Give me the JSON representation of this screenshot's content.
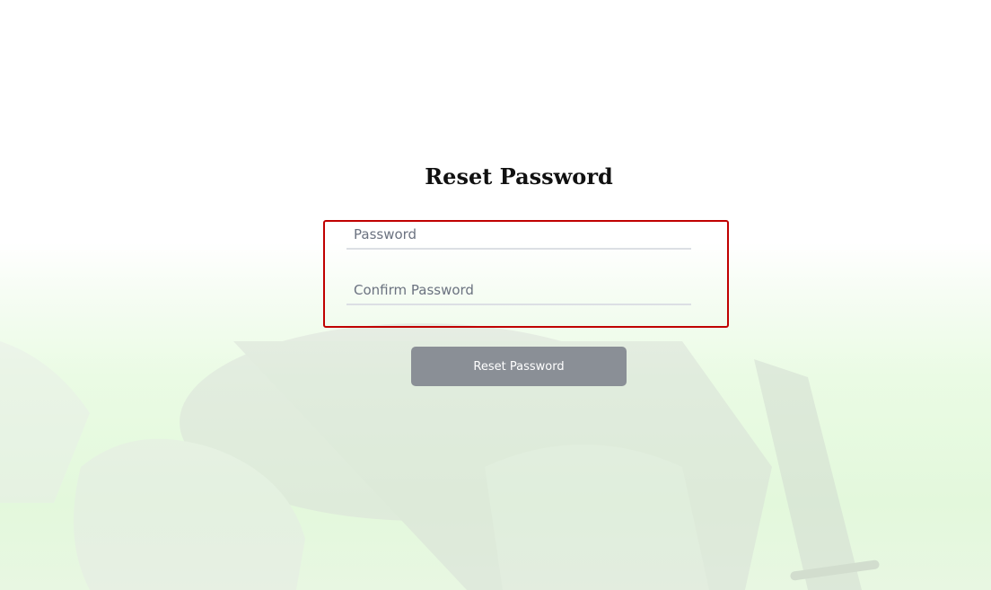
{
  "page": {
    "title": "Reset Password"
  },
  "form": {
    "password": {
      "value": "",
      "placeholder": "Password"
    },
    "confirm_password": {
      "value": "",
      "placeholder": "Confirm Password"
    },
    "submit_label": "Reset Password"
  },
  "colors": {
    "highlight_border": "#c00000",
    "button_bg": "#8a8f96",
    "background_tint": "#e3f8dc"
  }
}
